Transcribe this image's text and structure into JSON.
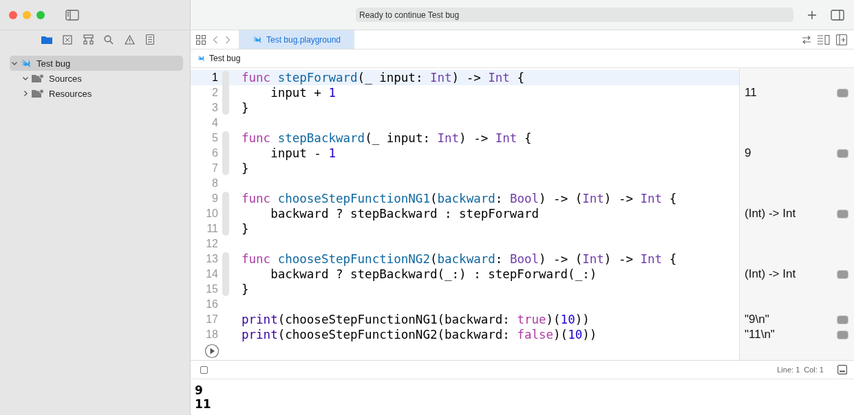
{
  "toolbar": {
    "status": "Ready to continue Test bug"
  },
  "navigator_tabs": [
    {
      "kind": "folder",
      "selected": true
    },
    {
      "kind": "xbox",
      "selected": false
    },
    {
      "kind": "hierarchy",
      "selected": false
    },
    {
      "kind": "search",
      "selected": false
    },
    {
      "kind": "warning",
      "selected": false
    },
    {
      "kind": "list",
      "selected": false
    }
  ],
  "tree": [
    {
      "label": "Test bug",
      "kind": "playground",
      "expanded": true,
      "selected": true,
      "children": [
        {
          "label": "Sources",
          "kind": "folder",
          "expanded": true,
          "selected": false
        },
        {
          "label": "Resources",
          "kind": "folder",
          "expanded": false,
          "selected": false
        }
      ]
    }
  ],
  "editor_tab": {
    "label": "Test bug.playground",
    "selected": true
  },
  "breadcrumb": "Test bug",
  "code_lines": [
    {
      "number": "1",
      "selected": true,
      "tokens": [
        {
          "kind": "keyword",
          "text": "func"
        },
        {
          "kind": "decl",
          "text": " stepForward"
        },
        {
          "kind": "plain",
          "text": "(_ input: "
        },
        {
          "kind": "type",
          "text": "Int"
        },
        {
          "kind": "plain",
          "text": ") -> "
        },
        {
          "kind": "type",
          "text": "Int"
        },
        {
          "kind": "plain",
          "text": " {"
        }
      ]
    },
    {
      "number": "2",
      "selected": false,
      "tokens": [
        {
          "kind": "plain",
          "text": "    input + "
        },
        {
          "kind": "number",
          "text": "1"
        }
      ],
      "result": "11"
    },
    {
      "number": "3",
      "selected": false,
      "tokens": [
        {
          "kind": "plain",
          "text": "}"
        }
      ]
    },
    {
      "number": "4",
      "selected": false
    },
    {
      "number": "5",
      "selected": false,
      "tokens": [
        {
          "kind": "keyword",
          "text": "func"
        },
        {
          "kind": "decl",
          "text": " stepBackward"
        },
        {
          "kind": "plain",
          "text": "(_ input: "
        },
        {
          "kind": "type",
          "text": "Int"
        },
        {
          "kind": "plain",
          "text": ") -> "
        },
        {
          "kind": "type",
          "text": "Int"
        },
        {
          "kind": "plain",
          "text": " {"
        }
      ]
    },
    {
      "number": "6",
      "selected": false,
      "tokens": [
        {
          "kind": "plain",
          "text": "    input - "
        },
        {
          "kind": "number",
          "text": "1"
        }
      ],
      "result": "9"
    },
    {
      "number": "7",
      "selected": false,
      "tokens": [
        {
          "kind": "plain",
          "text": "}"
        }
      ]
    },
    {
      "number": "8",
      "selected": false
    },
    {
      "number": "9",
      "selected": false,
      "tokens": [
        {
          "kind": "keyword",
          "text": "func"
        },
        {
          "kind": "decl",
          "text": " chooseStepFunctionNG1"
        },
        {
          "kind": "plain",
          "text": "("
        },
        {
          "kind": "decl",
          "text": "backward"
        },
        {
          "kind": "plain",
          "text": ": "
        },
        {
          "kind": "type",
          "text": "Bool"
        },
        {
          "kind": "plain",
          "text": ") -> ("
        },
        {
          "kind": "type",
          "text": "Int"
        },
        {
          "kind": "plain",
          "text": ") -> "
        },
        {
          "kind": "type",
          "text": "Int"
        },
        {
          "kind": "plain",
          "text": " {"
        }
      ]
    },
    {
      "number": "10",
      "selected": false,
      "tokens": [
        {
          "kind": "plain",
          "text": "    backward ? stepBackward : stepForward"
        }
      ],
      "result": "(Int) -> Int"
    },
    {
      "number": "11",
      "selected": false,
      "tokens": [
        {
          "kind": "plain",
          "text": "}"
        }
      ]
    },
    {
      "number": "12",
      "selected": false
    },
    {
      "number": "13",
      "selected": false,
      "tokens": [
        {
          "kind": "keyword",
          "text": "func"
        },
        {
          "kind": "decl",
          "text": " chooseStepFunctionNG2"
        },
        {
          "kind": "plain",
          "text": "("
        },
        {
          "kind": "decl",
          "text": "backward"
        },
        {
          "kind": "plain",
          "text": ": "
        },
        {
          "kind": "type",
          "text": "Bool"
        },
        {
          "kind": "plain",
          "text": ") -> ("
        },
        {
          "kind": "type",
          "text": "Int"
        },
        {
          "kind": "plain",
          "text": ") -> "
        },
        {
          "kind": "type",
          "text": "Int"
        },
        {
          "kind": "plain",
          "text": " {"
        }
      ]
    },
    {
      "number": "14",
      "selected": false,
      "tokens": [
        {
          "kind": "plain",
          "text": "    backward ? stepBackward(_:) : stepForward(_:)"
        }
      ],
      "result": "(Int) -> Int"
    },
    {
      "number": "15",
      "selected": false,
      "tokens": [
        {
          "kind": "plain",
          "text": "}"
        }
      ]
    },
    {
      "number": "16",
      "selected": false
    },
    {
      "number": "17",
      "selected": false,
      "tokens": [
        {
          "kind": "call",
          "text": "print"
        },
        {
          "kind": "plain",
          "text": "(chooseStepFunctionNG1(backward: "
        },
        {
          "kind": "keyword",
          "text": "true"
        },
        {
          "kind": "plain",
          "text": ")("
        },
        {
          "kind": "number",
          "text": "10"
        },
        {
          "kind": "plain",
          "text": "))"
        }
      ],
      "result": "\"9\\n\""
    },
    {
      "number": "18",
      "selected": false,
      "tokens": [
        {
          "kind": "call",
          "text": "print"
        },
        {
          "kind": "plain",
          "text": "(chooseStepFunctionNG2(backward: "
        },
        {
          "kind": "keyword",
          "text": "false"
        },
        {
          "kind": "plain",
          "text": ")("
        },
        {
          "kind": "number",
          "text": "10"
        },
        {
          "kind": "plain",
          "text": "))"
        }
      ],
      "result": "\"11\\n\""
    }
  ],
  "debug_bar": {
    "line": "Line: 1",
    "col": "Col: 1",
    "console_checked": false
  },
  "console": [
    "9",
    "11"
  ]
}
